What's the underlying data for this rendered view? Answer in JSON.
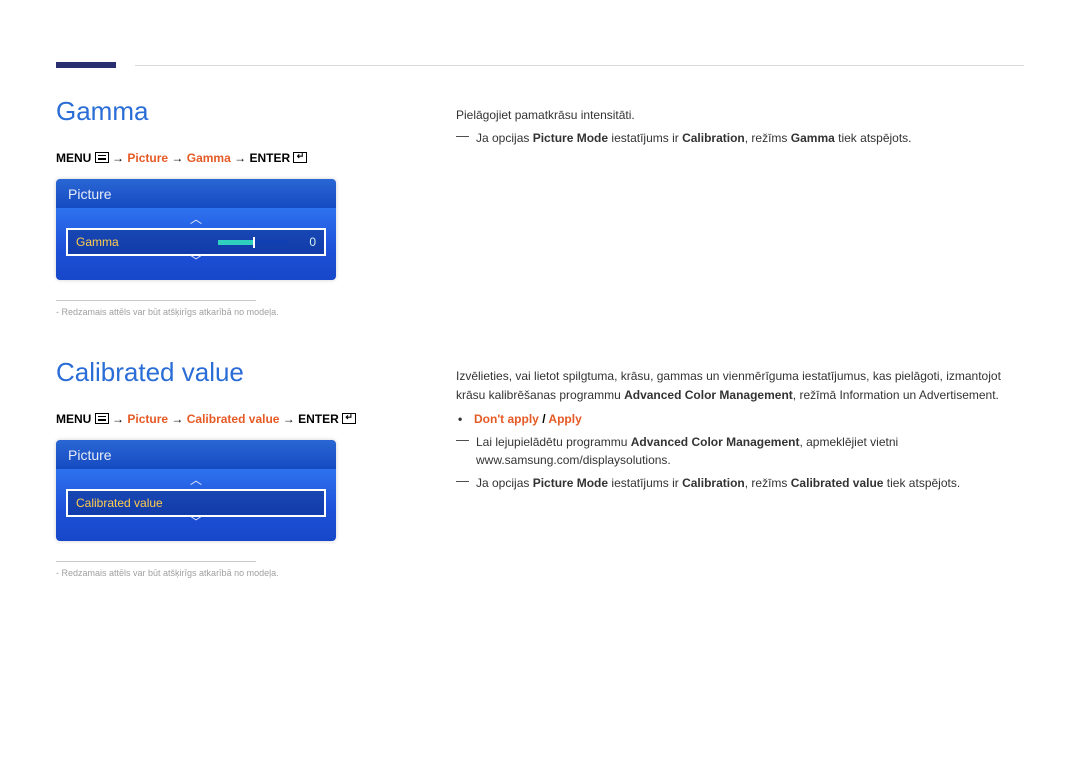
{
  "header": {},
  "section1": {
    "title": "Gamma",
    "breadcrumb": {
      "menu": "MENU",
      "picture": "Picture",
      "item": "Gamma",
      "enter": "ENTER"
    },
    "osd": {
      "panel_title": "Picture",
      "row_label": "Gamma",
      "value": "0"
    },
    "note": "Redzamais attēls var būt atšķirīgs atkarībā no modeļa.",
    "desc": {
      "line1": "Pielāgojiet pamatkrāsu intensitāti.",
      "dash_prefix": "Ja opcijas ",
      "dash_b1": "Picture Mode",
      "dash_mid": " iestatījums ir ",
      "dash_b2": "Calibration",
      "dash_mid2": ", režīms ",
      "dash_b3": "Gamma",
      "dash_suffix": " tiek atspējots."
    }
  },
  "section2": {
    "title": "Calibrated value",
    "breadcrumb": {
      "menu": "MENU",
      "picture": "Picture",
      "item": "Calibrated value",
      "enter": "ENTER"
    },
    "osd": {
      "panel_title": "Picture",
      "row_label": "Calibrated value"
    },
    "note": "Redzamais attēls var būt atšķirīgs atkarībā no modeļa.",
    "desc": {
      "para_pre": "Izvēlieties, vai lietot spilgtuma, krāsu, gammas un vienmērīguma iestatījumus, kas pielāgoti, izmantojot krāsu kalibrēšanas programmu ",
      "para_b1": "Advanced Color Management",
      "para_post": ", režīmā Information un Advertisement.",
      "bullet_a": "Don't apply",
      "bullet_sep": " / ",
      "bullet_b": "Apply",
      "dash1_pre": "Lai lejupielādētu programmu ",
      "dash1_b1": "Advanced Color Management",
      "dash1_post": ", apmeklējiet vietni www.samsung.com/displaysolutions.",
      "dash2_pre": "Ja opcijas ",
      "dash2_b1": "Picture Mode",
      "dash2_mid": " iestatījums ir ",
      "dash2_b2": "Calibration",
      "dash2_mid2": ", režīms ",
      "dash2_b3": "Calibrated value",
      "dash2_post": " tiek atspējots."
    }
  }
}
